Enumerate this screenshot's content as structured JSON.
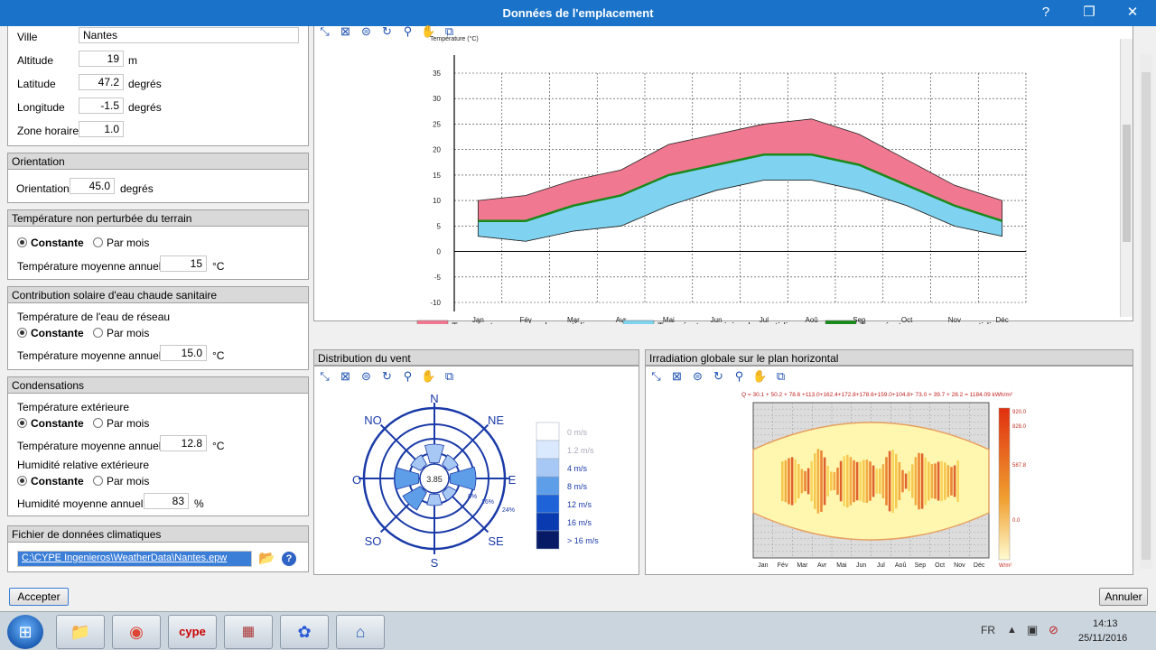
{
  "window": {
    "title": "Données de l'emplacement",
    "help": "?",
    "restore": "❐",
    "close": "✕"
  },
  "location": {
    "city_label": "Ville",
    "city": "Nantes",
    "alt_label": "Altitude",
    "alt": "19",
    "alt_unit": "m",
    "lat_label": "Latitude",
    "lat": "47.2",
    "lat_unit": "degrés",
    "lon_label": "Longitude",
    "lon": "-1.5",
    "lon_unit": "degrés",
    "tz_label": "Zone horaire",
    "tz": "1.0"
  },
  "orientation": {
    "header": "Orientation",
    "label": "Orientation",
    "value": "45.0",
    "unit": "degrés"
  },
  "ground": {
    "header": "Température non perturbée du terrain",
    "opt1": "Constante",
    "opt2": "Par mois",
    "label": "Température moyenne annuelle:",
    "value": "15",
    "unit": "°C"
  },
  "solar": {
    "header": "Contribution solaire d'eau chaude sanitaire",
    "sub": "Température de l'eau de réseau",
    "opt1": "Constante",
    "opt2": "Par mois",
    "label": "Température moyenne annuelle:",
    "value": "15.0",
    "unit": "°C"
  },
  "cond": {
    "header": "Condensations",
    "sub1": "Température extérieure",
    "opt1": "Constante",
    "opt2": "Par mois",
    "label1": "Température moyenne annuelle:",
    "value1": "12.8",
    "unit1": "°C",
    "sub2": "Humidité relative extérieure",
    "opt3": "Constante",
    "opt4": "Par mois",
    "label2": "Humidité moyenne annuelle:",
    "value2": "83",
    "unit2": "%"
  },
  "file": {
    "header": "Fichier de données climatiques",
    "path": "C:\\CYPE Ingenieros\\WeatherData\\Nantes.epw"
  },
  "buttons": {
    "accept": "Accepter",
    "cancel": "Annuler"
  },
  "temp_chart": {
    "title": "Température (°C)",
    "legend": [
      "Température maximale quotidienne",
      "Température minimale quotidienne",
      "Température moyenne quotidienne"
    ],
    "colors": [
      "#f07890",
      "#7fd3f0",
      "#1a8a1a"
    ]
  },
  "chart_data": [
    {
      "type": "area",
      "title": "Température (°C)",
      "ylim": [
        -10,
        35
      ],
      "yticks": [
        35,
        30,
        25,
        20,
        15,
        10,
        5,
        0,
        -5,
        -10
      ],
      "categories": [
        "Jan",
        "Fév",
        "Mar",
        "Avr",
        "Mai",
        "Jun",
        "Jul",
        "Aoû",
        "Sep",
        "Oct",
        "Nov",
        "Déc"
      ],
      "grid": true,
      "legend": "bottom",
      "series": [
        {
          "name": "Température maximale quotidienne",
          "values": [
            10,
            11,
            14,
            16,
            21,
            23,
            25,
            26,
            23,
            18,
            13,
            10
          ]
        },
        {
          "name": "Température minimale quotidienne",
          "values": [
            3,
            2,
            4,
            5,
            9,
            12,
            14,
            14,
            12,
            9,
            5,
            3
          ]
        },
        {
          "name": "Température moyenne quotidienne",
          "values": [
            6,
            6,
            9,
            11,
            15,
            17,
            19,
            19,
            17,
            13,
            9,
            6
          ]
        }
      ]
    }
  ],
  "wind": {
    "header": "Distribution du vent",
    "dirs": [
      "N",
      "NE",
      "E",
      "SE",
      "S",
      "SO",
      "O",
      "NO"
    ],
    "center": "3.85",
    "rings": [
      "8%",
      "16%",
      "24%"
    ],
    "legend": [
      "0 m/s",
      "1.2 m/s",
      "4 m/s",
      "8 m/s",
      "12 m/s",
      "16 m/s",
      "> 16 m/s"
    ],
    "colors": [
      "#ffffff",
      "#dbe9ff",
      "#a7c8f5",
      "#5e9ee8",
      "#1e63d8",
      "#0a3ab0",
      "#061a66"
    ]
  },
  "irr": {
    "header": "Irradiation globale sur le plan horizontal",
    "summary": "Q = 30.1 + 50.2 + 78.6 +113.0+162.4+172.8+178.6+159.0+104.8+ 73.0 + 39.7 + 28.2 = 1184.09 kWh/m²",
    "months": [
      "Jan",
      "Fév",
      "Mar",
      "Avr",
      "Mai",
      "Jun",
      "Jul",
      "Aoû",
      "Sep",
      "Oct",
      "Nov",
      "Déc"
    ],
    "scale": [
      "920.0",
      "828.0",
      "587.8",
      "0.0"
    ],
    "scale_unit": "W/m²"
  },
  "taskbar": {
    "lang": "FR",
    "time": "14:13",
    "date": "25/11/2016"
  }
}
